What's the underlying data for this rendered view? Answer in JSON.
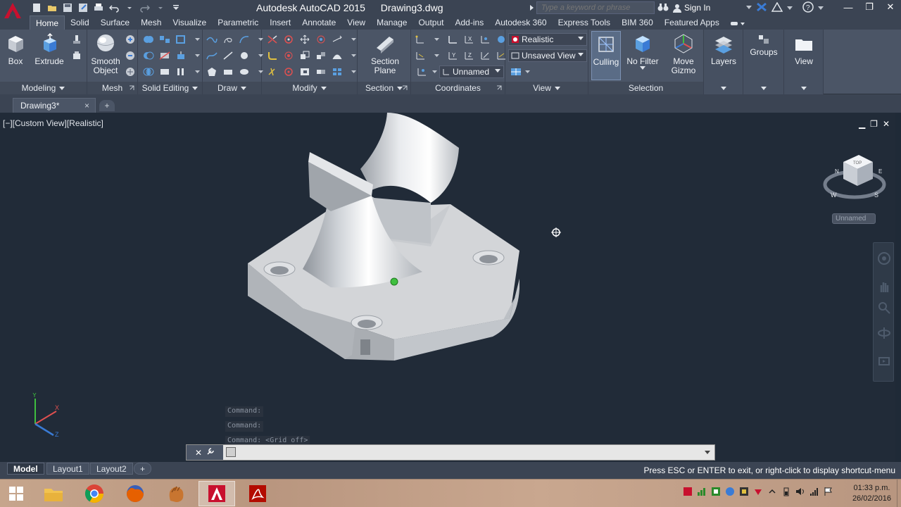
{
  "window": {
    "app_name": "Autodesk AutoCAD 2015",
    "document_name": "Drawing3.dwg",
    "search_placeholder": "Type a keyword or phrase",
    "sign_in_label": "Sign In"
  },
  "ribbon_tabs": [
    "Home",
    "Solid",
    "Surface",
    "Mesh",
    "Visualize",
    "Parametric",
    "Insert",
    "Annotate",
    "View",
    "Manage",
    "Output",
    "Add-ins",
    "Autodesk 360",
    "Express Tools",
    "BIM 360",
    "Featured Apps"
  ],
  "ribbon": {
    "modeling": {
      "title": "Modeling",
      "box": "Box",
      "extrude": "Extrude"
    },
    "mesh": {
      "title": "Mesh",
      "smooth_line1": "Smooth",
      "smooth_line2": "Object"
    },
    "solid_editing": {
      "title": "Solid Editing"
    },
    "draw": {
      "title": "Draw"
    },
    "modify": {
      "title": "Modify"
    },
    "section": {
      "title": "Section",
      "plane_line1": "Section",
      "plane_line2": "Plane"
    },
    "coordinates": {
      "title": "Coordinates",
      "ucs_value": "Unnamed"
    },
    "view": {
      "title": "View",
      "visual_style": "Realistic",
      "named_view": "Unsaved View"
    },
    "selection": {
      "title": "Selection",
      "culling": "Culling",
      "no_filter": "No Filter",
      "move_line1": "Move",
      "move_line2": "Gizmo"
    },
    "layers": "Layers",
    "groups": "Groups",
    "view_btn": "View"
  },
  "file_tabs": {
    "active": "Drawing3*",
    "close": "×",
    "new": "+"
  },
  "viewport": {
    "label": "[−][Custom View][Realistic]",
    "ucs_name": "Unnamed",
    "viewcube": {
      "top": "TOP",
      "n": "N",
      "e": "E",
      "s": "S",
      "w": "W"
    }
  },
  "command": {
    "history": [
      "Command:",
      "Command:",
      "Command:  <Grid off>"
    ],
    "input_value": ""
  },
  "layout_tabs": [
    "Model",
    "Layout1",
    "Layout2"
  ],
  "layout_add": "+",
  "status_message": "Press ESC or ENTER to exit, or right-click to display shortcut-menu",
  "taskbar": {
    "time": "01:33 p.m.",
    "date": "26/02/2016"
  },
  "colors": {
    "autocad_red": "#c8102e",
    "ribbon_bg": "#4b5566",
    "viewport_bg": "#212b38"
  }
}
